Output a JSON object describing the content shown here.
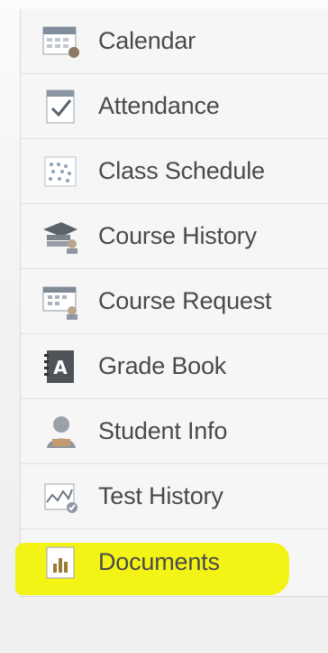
{
  "menu": {
    "items": [
      {
        "label": "Calendar",
        "icon": "calendar-icon"
      },
      {
        "label": "Attendance",
        "icon": "attendance-icon"
      },
      {
        "label": "Class Schedule",
        "icon": "class-schedule-icon"
      },
      {
        "label": "Course History",
        "icon": "course-history-icon"
      },
      {
        "label": "Course Request",
        "icon": "course-request-icon"
      },
      {
        "label": "Grade Book",
        "icon": "grade-book-icon"
      },
      {
        "label": "Student Info",
        "icon": "student-info-icon"
      },
      {
        "label": "Test History",
        "icon": "test-history-icon"
      },
      {
        "label": "Documents",
        "icon": "documents-icon",
        "highlighted": true
      }
    ]
  },
  "colors": {
    "highlight": "#f2f20a",
    "label": "#4a4a4a"
  }
}
